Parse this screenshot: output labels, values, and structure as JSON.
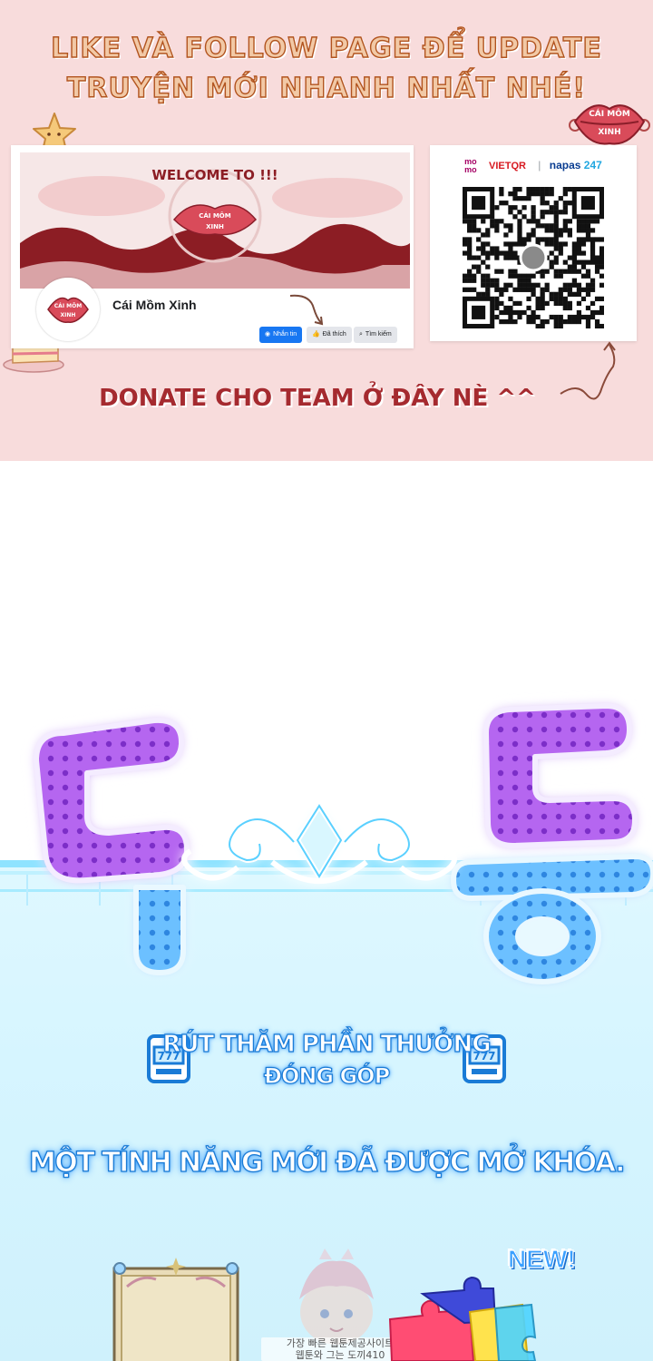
{
  "promo": {
    "headline_line1": "LIKE VÀ FOLLOW PAGE ĐỂ UPDATE",
    "headline_line2": "TRUYỆN MỚI NHANH NHẤT NHÉ!",
    "donate_text": "DONATE CHO TEAM Ở ĐÂY NÈ ^^",
    "badge_line1": "CÁI MÔM",
    "badge_line2": "XINH",
    "facebook": {
      "cover_text": "WELCOME TO !!!",
      "cover_badge_line1": "CÁI MÔM",
      "cover_badge_line2": "XINH",
      "page_name": "Cái Mồm Xinh",
      "message_button": "Nhắn tin",
      "liked_button": "Đã thích",
      "search_button": "Tìm kiếm"
    },
    "payment": {
      "momo_top": "mo",
      "momo_bottom": "mo",
      "vietqr": "VIETQR",
      "napas": "napas",
      "napas_num": "247"
    }
  },
  "scene": {
    "reward_line1": "RÚT THĂM PHẦN THƯỞNG",
    "reward_line2": "ĐÓNG GÓP",
    "unlock_text": "MỘT TÍNH NĂNG MỚI ĐÃ ĐƯỢC MỞ KHÓA.",
    "new_badge": "NEW!",
    "watermark_line1": "가장 빠른 웹툰제공사이트",
    "watermark_line2": "웹툰와 그는 도끼410"
  },
  "colors": {
    "promo_bg": "#f8dcdc",
    "headline_fill": "#f2c9a6",
    "donate_red": "#a52a2f",
    "facebook_blue": "#1877f2",
    "title_purple": "#9b4de0",
    "title_blue": "#5fb6ff",
    "reward_stroke": "#1a7bd6"
  },
  "icons": [
    "star-icon",
    "cake-icon",
    "lips-badge-icon",
    "curly-arrow-icon",
    "messenger-icon",
    "thumbs-up-icon",
    "search-icon",
    "qr-code",
    "slot-machine-icon",
    "puzzle-icon"
  ]
}
